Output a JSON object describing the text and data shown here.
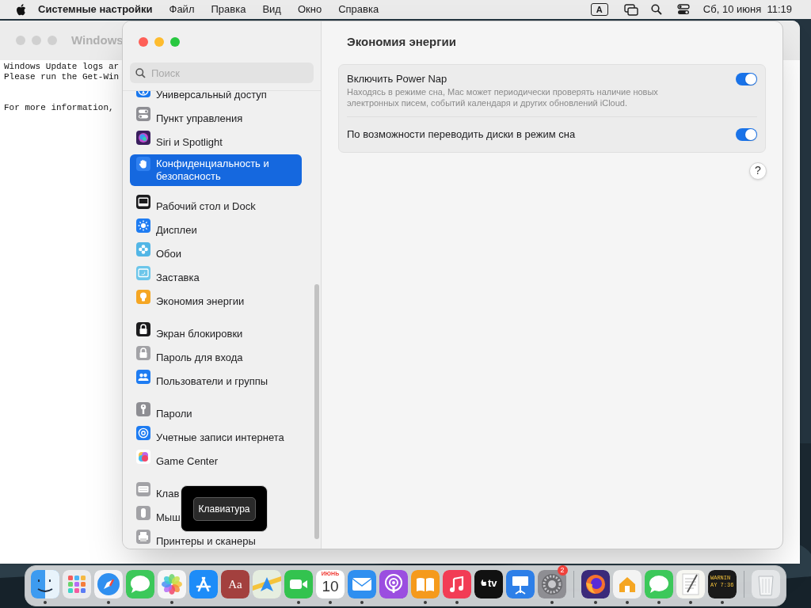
{
  "menu_bar": {
    "app_name": "Системные настройки",
    "menus": [
      "Файл",
      "Правка",
      "Вид",
      "Окно",
      "Справка"
    ],
    "input_source": "A",
    "clock": "Сб, 10 июня  11:19"
  },
  "back_window": {
    "title": "Windows",
    "paragraphs": [
      [
        "Windows Update logs ar",
        "Please run the Get-Win"
      ],
      [
        "For more information,"
      ]
    ]
  },
  "settings_window": {
    "search": {
      "placeholder": "Поиск"
    },
    "sidebar": {
      "groups": [
        [
          {
            "label": "Универсальный доступ",
            "kind": "person",
            "color": "#1a78ee",
            "selected": false
          },
          {
            "label": "Пункт управления",
            "kind": "toggle",
            "color": "#8e8e93",
            "selected": false
          },
          {
            "label": "Siri и Spotlight",
            "kind": "orb",
            "color": "#3a1f5e",
            "selected": false
          },
          {
            "label": "Конфиденциальность и безопасность",
            "kind": "hand",
            "color": "#2f80f0",
            "selected": true
          }
        ],
        [
          {
            "label": "Рабочий стол и Dock",
            "kind": "window",
            "color": "#1c1c1e",
            "selected": false
          },
          {
            "label": "Дисплеи",
            "kind": "sun",
            "color": "#1e7cf2",
            "selected": false
          },
          {
            "label": "Обои",
            "kind": "flower",
            "color": "#52b6e6",
            "selected": false
          },
          {
            "label": "Заставка",
            "kind": "screen",
            "color": "#6cc6ea",
            "selected": false
          },
          {
            "label": "Экономия энергии",
            "kind": "bulb",
            "color": "#f5a623",
            "selected": false
          }
        ],
        [
          {
            "label": "Экран блокировки",
            "kind": "lock",
            "color": "#1c1c1e",
            "selected": false
          },
          {
            "label": "Пароль для входа",
            "kind": "lock",
            "color": "#a2a2a6",
            "selected": false
          },
          {
            "label": "Пользователи и группы",
            "kind": "people",
            "color": "#1e7cf2",
            "selected": false
          }
        ],
        [
          {
            "label": "Пароли",
            "kind": "key",
            "color": "#8e8e93",
            "selected": false
          },
          {
            "label": "Учетные записи интернета",
            "kind": "at",
            "color": "#1e7cf2",
            "selected": false
          },
          {
            "label": "Game Center",
            "kind": "bubbles",
            "color": "#ffffff",
            "selected": false
          }
        ],
        [
          {
            "label": "Клав",
            "kind": "keyboard",
            "color": "#a2a2a6",
            "selected": false
          },
          {
            "label": "Мыш",
            "kind": "mouse",
            "color": "#a2a2a6",
            "selected": false
          },
          {
            "label": "Принтеры и сканеры",
            "kind": "printer",
            "color": "#a2a2a6",
            "selected": false
          }
        ]
      ]
    },
    "pane": {
      "title": "Экономия энергии",
      "settings": [
        {
          "label": "Включить Power Nap",
          "description": "Находясь в режиме сна, Mac может периодически проверять наличие новых электронных писем, событий календаря и других обновлений iCloud.",
          "on": true
        },
        {
          "label": "По возможности переводить диски в режим сна",
          "on": true
        }
      ],
      "help": "?"
    }
  },
  "tooltip": {
    "text": "Клавиатура"
  },
  "dock": {
    "groups": [
      [
        {
          "kind": "finder",
          "color": "#3d9bf0",
          "running": true
        },
        {
          "kind": "launchpad",
          "color": "#ececee",
          "running": false
        },
        {
          "kind": "safari",
          "color": "#f4f4f6",
          "running": true
        },
        {
          "kind": "messages",
          "color": "#3cc85a",
          "running": false
        },
        {
          "kind": "photos",
          "color": "#f6f6f6",
          "running": true
        },
        {
          "kind": "appstore",
          "color": "#1d8cf8",
          "running": false
        },
        {
          "kind": "dictionary",
          "color": "#a3403e",
          "running": false,
          "text": "Aa"
        },
        {
          "kind": "maps",
          "color": "#e6eee0",
          "running": false
        },
        {
          "kind": "facetime",
          "color": "#33c34f",
          "running": true
        },
        {
          "kind": "calendar",
          "color": "#ffffff",
          "running": true,
          "month": "ИЮНЬ",
          "day": "10"
        },
        {
          "kind": "mail",
          "color": "#2f8ff0",
          "running": true
        },
        {
          "kind": "podcasts",
          "color": "#9b4ee0",
          "running": false
        },
        {
          "kind": "books",
          "color": "#f59a1c",
          "running": true
        },
        {
          "kind": "music",
          "color": "#f23c55",
          "running": true
        },
        {
          "kind": "tv",
          "color": "#111111",
          "running": false,
          "text": "tv"
        },
        {
          "kind": "keynote",
          "color": "#2d7fe8",
          "running": false
        },
        {
          "kind": "settings",
          "color": "#8e8e93",
          "running": true,
          "badge": "2"
        }
      ],
      [
        {
          "kind": "firefox",
          "color": "#3b2a7a",
          "running": true
        },
        {
          "kind": "home",
          "color": "#f3f3f3",
          "running": true
        },
        {
          "kind": "messages",
          "color": "#3cc85a",
          "running": true
        },
        {
          "kind": "textedit",
          "color": "#f7f7f2",
          "running": true
        },
        {
          "kind": "console",
          "color": "#1a1a1a",
          "running": true,
          "lines": [
            "WARNIN",
            "AY 7:36"
          ]
        }
      ],
      [
        {
          "kind": "trash",
          "color": "#e4e6e8",
          "running": false
        }
      ]
    ]
  }
}
